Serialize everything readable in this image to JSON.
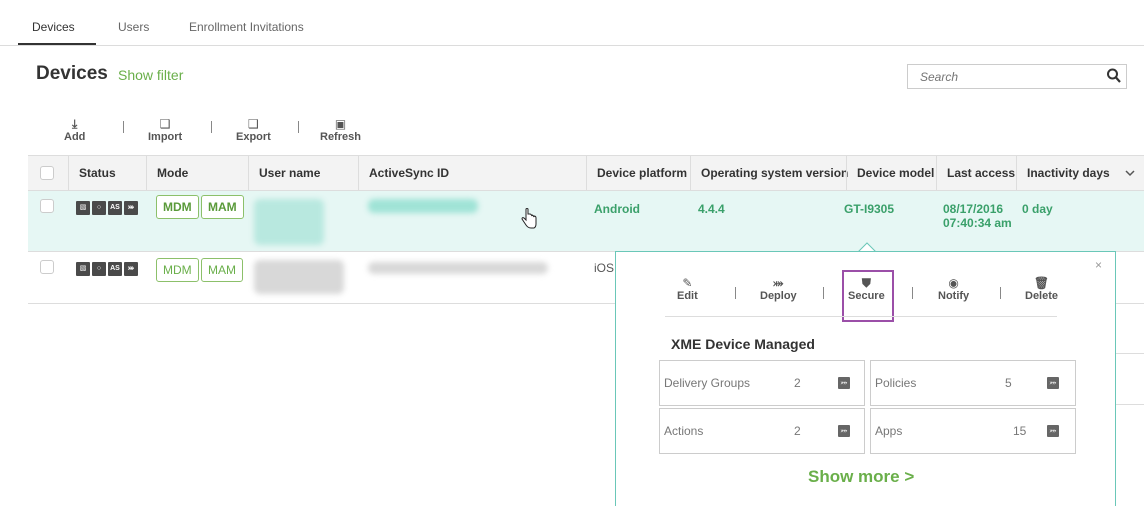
{
  "tabs": [
    {
      "label": "Devices",
      "active": true
    },
    {
      "label": "Users",
      "active": false
    },
    {
      "label": "Enrollment Invitations",
      "active": false
    }
  ],
  "page": {
    "title": "Devices",
    "show_filter": "Show filter"
  },
  "search": {
    "placeholder": "Search"
  },
  "toolbar": {
    "add": "Add",
    "import": "Import",
    "export": "Export",
    "refresh": "Refresh"
  },
  "columns": [
    "Status",
    "Mode",
    "User name",
    "ActiveSync ID",
    "Device platform",
    "Operating system version",
    "Device model",
    "Last access",
    "Inactivity days"
  ],
  "rows": [
    {
      "status_icons": [
        "device-icon",
        "power-icon",
        "AS",
        "shuffle-icon"
      ],
      "modes": [
        "MDM",
        "MAM"
      ],
      "platform": "Android",
      "os_version": "4.4.4",
      "model": "GT-I9305",
      "last_access_date": "08/17/2016",
      "last_access_time": "07:40:34 am",
      "inactivity": "0 day"
    },
    {
      "status_icons": [
        "device-icon",
        "power-icon",
        "AS",
        "shuffle-icon"
      ],
      "modes": [
        "MDM",
        "MAM"
      ],
      "platform": "iOS"
    }
  ],
  "popover": {
    "actions": {
      "edit": "Edit",
      "deploy": "Deploy",
      "secure": "Secure",
      "notify": "Notify",
      "delete": "Delete"
    },
    "title": "XME Device Managed",
    "stats": {
      "delivery_groups": {
        "label": "Delivery Groups",
        "value": "2"
      },
      "policies": {
        "label": "Policies",
        "value": "5"
      },
      "actions": {
        "label": "Actions",
        "value": "2"
      },
      "apps": {
        "label": "Apps",
        "value": "15"
      }
    },
    "show_more": "Show more >",
    "close": "×"
  },
  "colors": {
    "accent_green": "#6aaf4a",
    "row_highlight": "#e6f7f4",
    "popover_border": "#6ac7b8",
    "secure_highlight": "#9b4fa8",
    "data_green": "#3aa06a"
  }
}
